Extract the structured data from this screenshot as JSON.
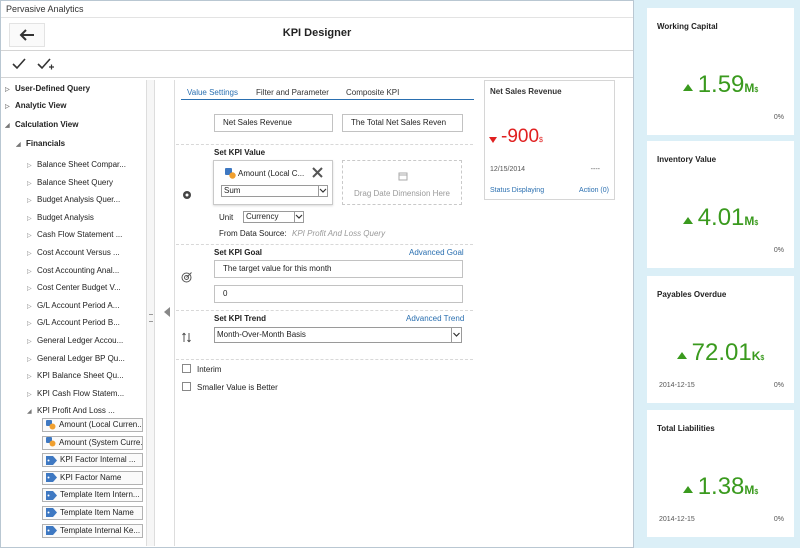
{
  "app": {
    "window_title": "Pervasive Analytics",
    "page_title": "KPI Designer"
  },
  "toolbar": {
    "save_icon": "checkmark-icon",
    "save_as_icon": "checkmark-plus-icon"
  },
  "sidebar": {
    "top_items": [
      {
        "label": "User-Defined Query",
        "bold": true,
        "expanded": false
      },
      {
        "label": "Analytic View",
        "bold": true,
        "expanded": false
      },
      {
        "label": "Calculation View",
        "bold": true,
        "expanded": true
      },
      {
        "label": "Financials",
        "bold": true,
        "expanded": true
      }
    ],
    "queries": [
      "Balance Sheet Compar...",
      "Balance Sheet Query",
      "Budget Analysis Quer...",
      "Budget Analysis",
      "Cash Flow Statement ...",
      "Cost Account Versus ...",
      "Cost Accounting Anal...",
      "Cost Center Budget V...",
      "G/L Account Period A...",
      "G/L Account Period B...",
      "General Ledger Accou...",
      "General Ledger BP Qu...",
      "KPI Balance Sheet Qu...",
      "KPI Cash Flow Statem...",
      "KPI Profit And Loss ..."
    ],
    "fields": [
      {
        "label": "Amount (Local Curren...",
        "icon": "measure-icon"
      },
      {
        "label": "Amount (System Curre...",
        "icon": "measure-icon"
      },
      {
        "label": "KPI Factor Internal ...",
        "icon": "dimension-tag-icon"
      },
      {
        "label": "KPI Factor Name",
        "icon": "dimension-tag-icon"
      },
      {
        "label": "Template Item Intern...",
        "icon": "dimension-tag-icon"
      },
      {
        "label": "Template Item Name",
        "icon": "dimension-tag-icon"
      },
      {
        "label": "Template Internal Ke...",
        "icon": "dimension-tag-icon"
      }
    ]
  },
  "tabs": [
    "Value Settings",
    "Filter and Parameter",
    "Composite KPI"
  ],
  "form": {
    "kpi_name": "Net Sales Revenue",
    "kpi_description": "The Total Net Sales Reven",
    "value_section": "Set KPI Value",
    "value_field": "Amount (Local C...",
    "aggregation": "Sum",
    "drop_zone": "Drag Date Dimension Here",
    "unit_label": "Unit",
    "unit_value": "Currency",
    "source_label": "From Data Source:",
    "source_value": "KPI Profit And Loss Query",
    "goal_section": "Set KPI Goal",
    "goal_link": "Advanced Goal",
    "goal_description": "The target value for this month",
    "goal_value": "0",
    "trend_section": "Set KPI Trend",
    "trend_link": "Advanced Trend",
    "trend_value": "Month-Over-Month Basis",
    "interim_label": "Interim",
    "interim_checked": false,
    "smaller_label": "Smaller Value is Better",
    "smaller_checked": false
  },
  "preview": {
    "title": "Net Sales Revenue",
    "value": "-900",
    "unit": "$",
    "trend": "down",
    "date": "12/15/2014",
    "goal": "----",
    "status_link": "Status Displaying",
    "action_link": "Action (0)",
    "colors": {
      "negative": "#e02020",
      "link": "#2a6fb0"
    }
  },
  "kpi_cards": [
    {
      "title": "Working Capital",
      "value": "1.59",
      "unit": "M",
      "unit_sub": "$",
      "date": "",
      "pct": "0%",
      "trend": "up"
    },
    {
      "title": "Inventory Value",
      "value": "4.01",
      "unit": "M",
      "unit_sub": "$",
      "date": "",
      "pct": "0%",
      "trend": "up"
    },
    {
      "title": "Payables Overdue",
      "value": "72.01",
      "unit": "K",
      "unit_sub": "$",
      "date": "2014-12-15",
      "pct": "0%",
      "trend": "up"
    },
    {
      "title": "Total Liabilities",
      "value": "1.38",
      "unit": "M",
      "unit_sub": "$",
      "date": "2014-12-15",
      "pct": "0%",
      "trend": "up"
    }
  ],
  "colors": {
    "accent": "#2a6fb0",
    "positive": "#3a9a1e",
    "panel_bg": "#dbeff7"
  }
}
